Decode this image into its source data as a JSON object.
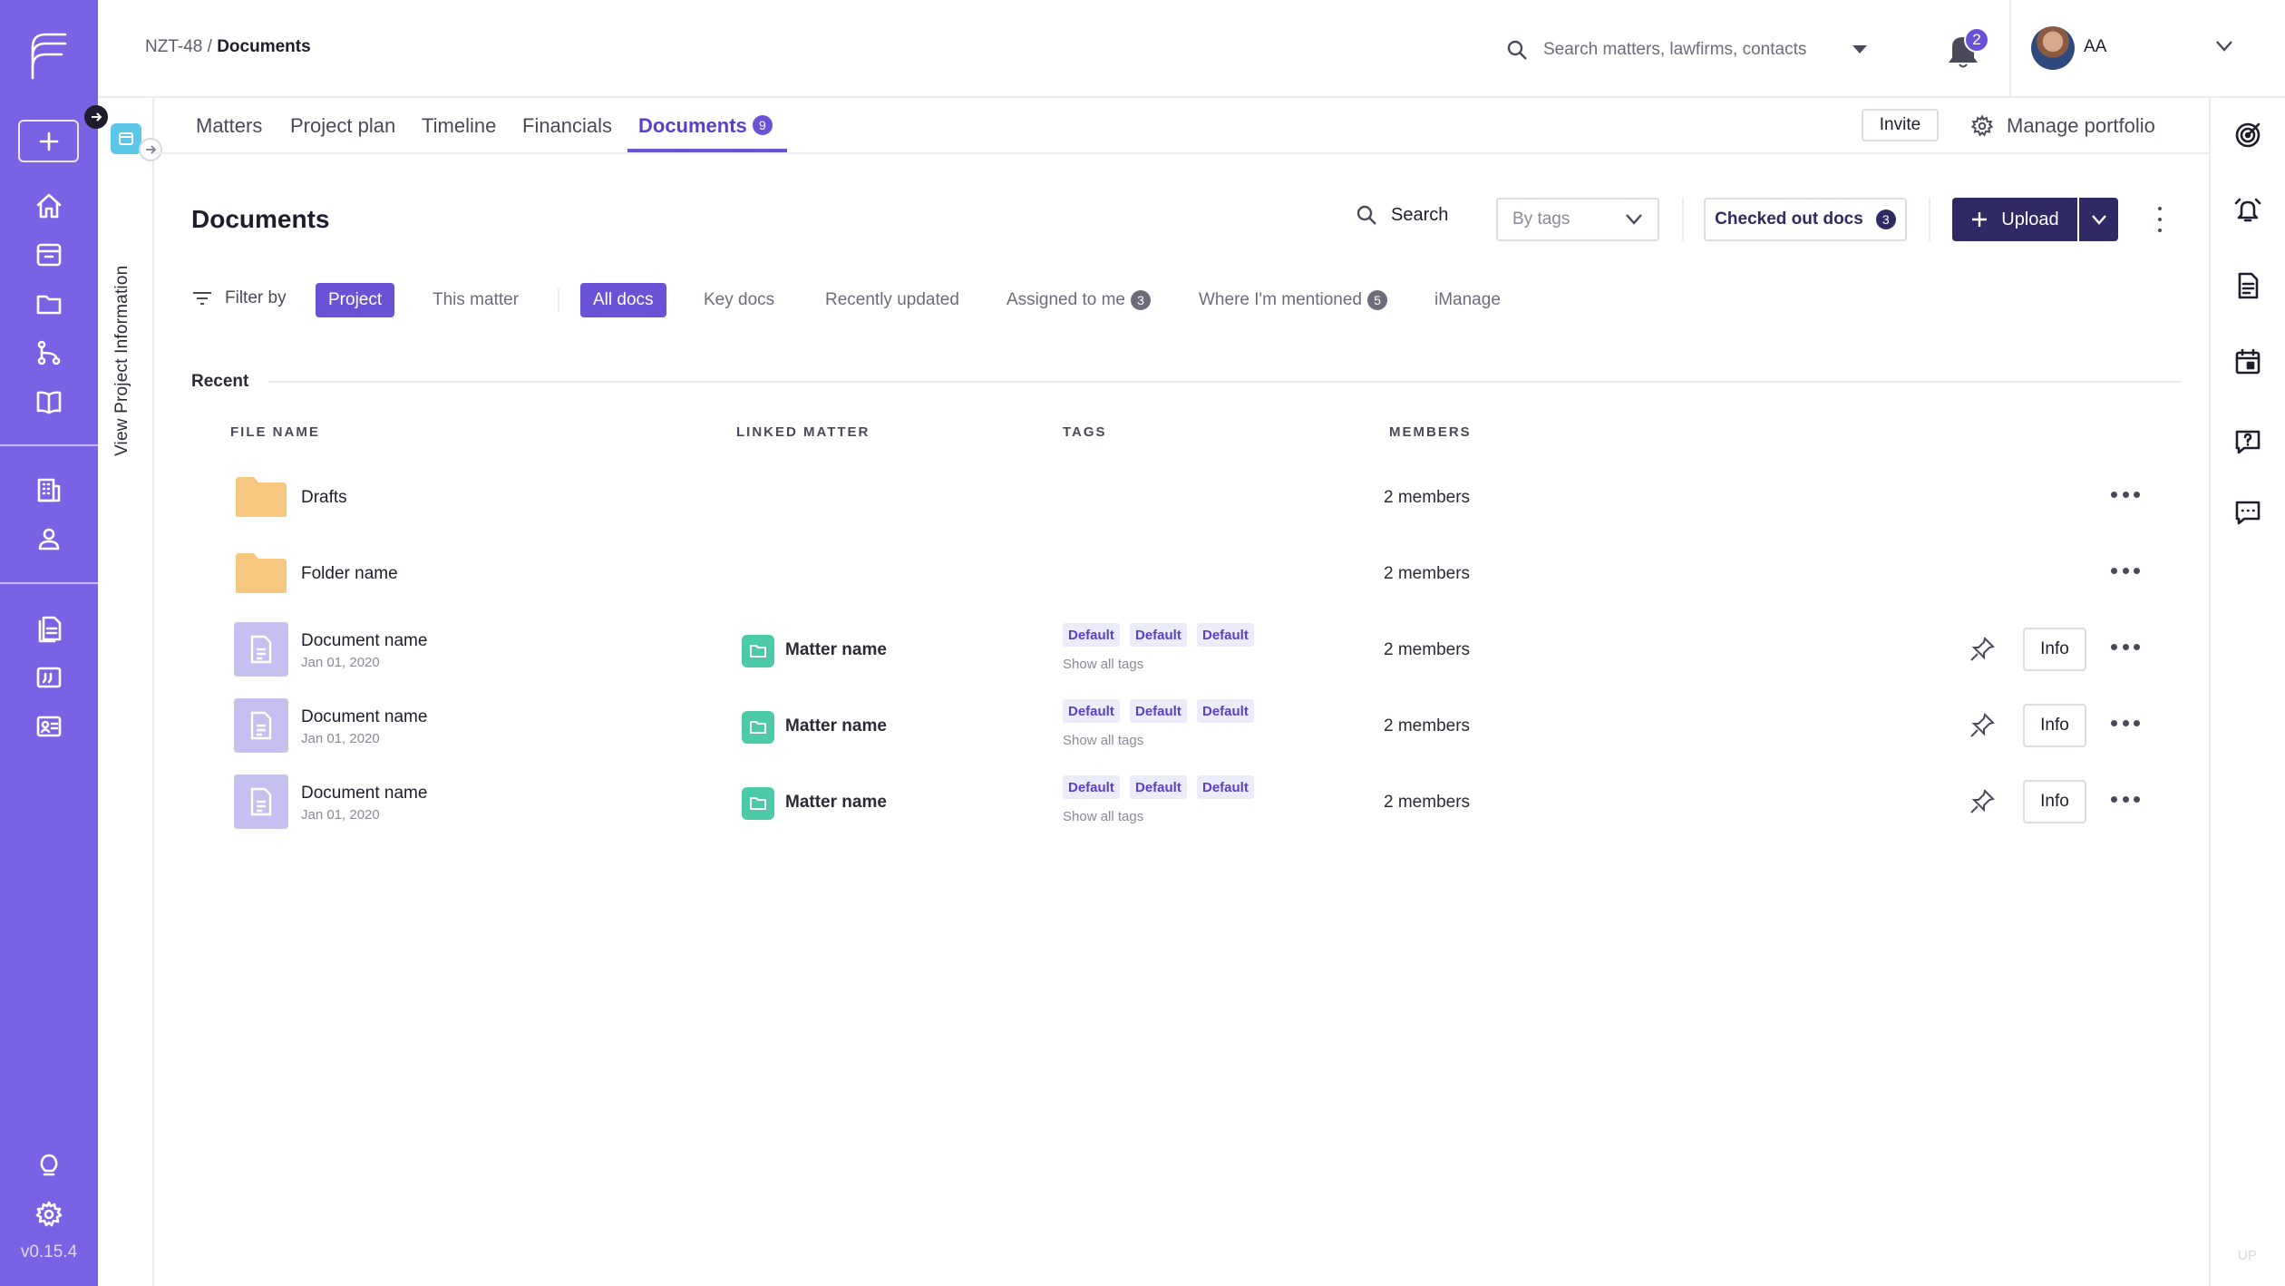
{
  "app": {
    "version": "v0.15.4",
    "colors": {
      "sidebar": "#7a62e4",
      "accent": "#6a52d6",
      "navy": "#2f2a63",
      "matter": "#4cc9a6",
      "folder": "#f6c77e"
    }
  },
  "header": {
    "breadcrumb_parent": "NZT-48 /",
    "breadcrumb_current": "Documents",
    "search_placeholder": "Search matters, lawfirms, contacts",
    "notifications_count": "2",
    "user_initials": "AA"
  },
  "project_strip": {
    "label": "View Project Information"
  },
  "tabs": [
    {
      "label": "Matters"
    },
    {
      "label": "Project plan"
    },
    {
      "label": "Timeline"
    },
    {
      "label": "Financials"
    },
    {
      "label": "Documents",
      "count": "9",
      "active": true
    }
  ],
  "tab_actions": {
    "invite": "Invite",
    "manage": "Manage portfolio"
  },
  "documents": {
    "title": "Documents",
    "search_label": "Search",
    "tags_placeholder": "By tags",
    "checked_out_label": "Checked out docs",
    "checked_out_count": "3",
    "upload_label": "Upload"
  },
  "filters": {
    "label": "Filter by",
    "scope": [
      {
        "label": "Project",
        "selected": true
      },
      {
        "label": "This matter",
        "selected": false
      }
    ],
    "views": [
      {
        "label": "All docs",
        "selected": true
      },
      {
        "label": "Key docs"
      },
      {
        "label": "Recently updated"
      },
      {
        "label": "Assigned to me",
        "count": "3"
      },
      {
        "label": "Where I'm mentioned",
        "count": "5"
      },
      {
        "label": "iManage"
      }
    ]
  },
  "section": {
    "label": "Recent"
  },
  "table": {
    "columns": [
      "FILE NAME",
      "LINKED MATTER",
      "TAGS",
      "MEMBERS"
    ],
    "rows": [
      {
        "type": "folder",
        "name": "Drafts",
        "members": "2 members"
      },
      {
        "type": "folder",
        "name": "Folder name",
        "members": "2 members"
      },
      {
        "type": "document",
        "name": "Document name",
        "date": "Jan 01, 2020",
        "matter": "Matter name",
        "tags": [
          "Default",
          "Default",
          "Default"
        ],
        "show_tags": "Show all tags",
        "members": "2 members",
        "info": "Info"
      },
      {
        "type": "document",
        "name": "Document name",
        "date": "Jan 01, 2020",
        "matter": "Matter name",
        "tags": [
          "Default",
          "Default",
          "Default"
        ],
        "show_tags": "Show all tags",
        "members": "2 members",
        "info": "Info"
      },
      {
        "type": "document",
        "name": "Document name",
        "date": "Jan 01, 2020",
        "matter": "Matter name",
        "tags": [
          "Default",
          "Default",
          "Default"
        ],
        "show_tags": "Show all tags",
        "members": "2 members",
        "info": "Info"
      }
    ]
  },
  "right_rail": {
    "footer": "UP"
  }
}
